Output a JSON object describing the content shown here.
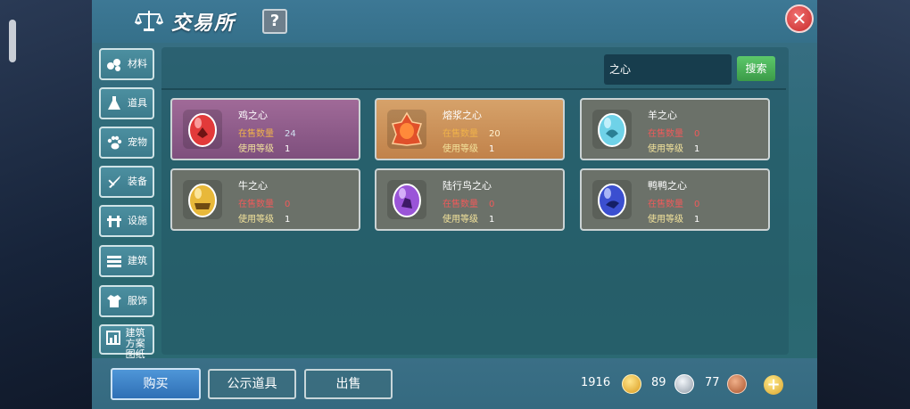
{
  "header": {
    "title": "交易所",
    "help_label": "?",
    "close_label": "✕"
  },
  "sidebar": {
    "items": [
      {
        "label": "材料"
      },
      {
        "label": "道具"
      },
      {
        "label": "宠物"
      },
      {
        "label": "装备"
      },
      {
        "label": "设施"
      },
      {
        "label": "建筑"
      },
      {
        "label": "服饰"
      },
      {
        "label": "建筑方案图纸"
      }
    ]
  },
  "search": {
    "value": "之心",
    "button_label": "搜索"
  },
  "items": [
    {
      "name": "鸡之心",
      "sale_label": "在售数量",
      "sale_count": "24",
      "level_label": "使用等级",
      "level": "1",
      "gem_color": "#e23a3a",
      "bg": "purple"
    },
    {
      "name": "熔浆之心",
      "sale_label": "在售数量",
      "sale_count": "20",
      "level_label": "使用等级",
      "level": "1",
      "gem_color": "#e0502a",
      "bg": "orange"
    },
    {
      "name": "羊之心",
      "sale_label": "在售数量",
      "sale_count": "0",
      "level_label": "使用等级",
      "level": "1",
      "gem_color": "#6fd2e8",
      "bg": "gray"
    },
    {
      "name": "牛之心",
      "sale_label": "在售数量",
      "sale_count": "0",
      "level_label": "使用等级",
      "level": "1",
      "gem_color": "#e8b83a",
      "bg": "gray"
    },
    {
      "name": "陆行鸟之心",
      "sale_label": "在售数量",
      "sale_count": "0",
      "level_label": "使用等级",
      "level": "1",
      "gem_color": "#9a55d8",
      "bg": "gray"
    },
    {
      "name": "鸭鸭之心",
      "sale_label": "在售数量",
      "sale_count": "0",
      "level_label": "使用等级",
      "level": "1",
      "gem_color": "#3b4fd0",
      "bg": "gray"
    }
  ],
  "bottom": {
    "buy_label": "购买",
    "public_label": "公示道具",
    "sell_label": "出售"
  },
  "currency": {
    "gold": "1916",
    "silver": "89",
    "copper": "77"
  },
  "colors": {
    "gold_coin": "#e6b43a",
    "silver_coin": "#b8c2cc",
    "copper_coin": "#c9744a"
  }
}
